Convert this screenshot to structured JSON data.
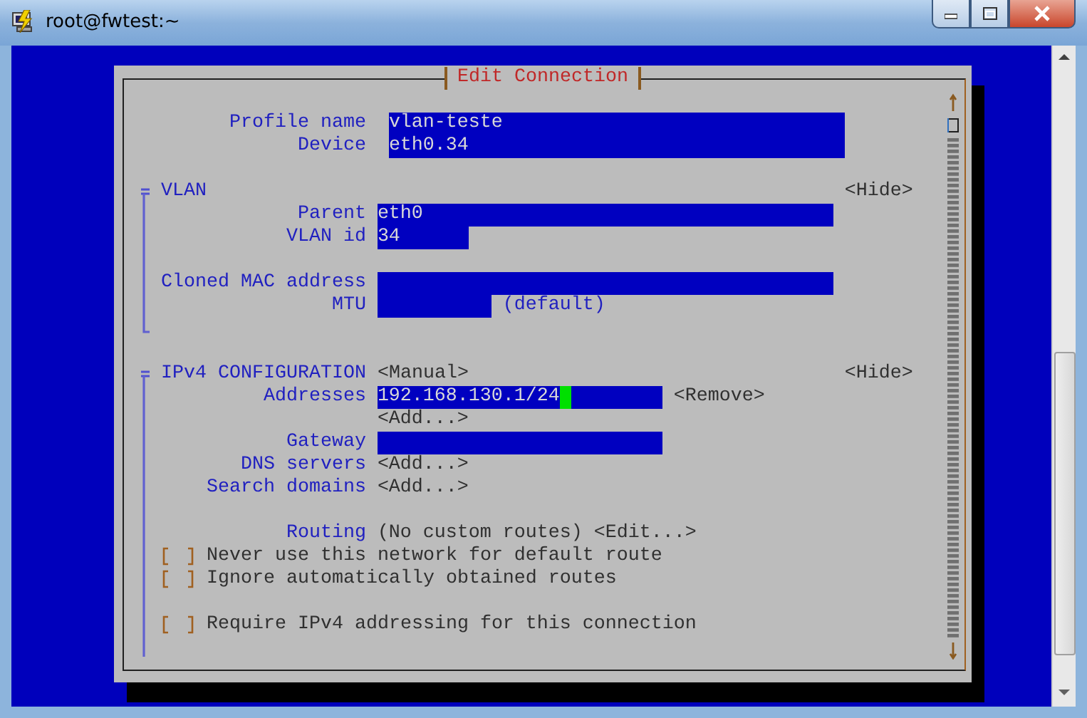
{
  "window": {
    "title": "root@fwtest:~"
  },
  "dialog": {
    "title": "Edit Connection"
  },
  "fields": [
    {
      "label": "Profile name",
      "value": "vlan-teste"
    },
    {
      "label": "Device",
      "value": "eth0.34"
    }
  ],
  "sections": [
    {
      "title": "VLAN",
      "hide_button": "<Hide>",
      "rows": [
        {
          "kind": "field",
          "label": "Parent",
          "value": "eth0"
        },
        {
          "kind": "field",
          "label": "VLAN id",
          "value": "34"
        },
        {
          "kind": "blank"
        },
        {
          "kind": "field",
          "label": "Cloned MAC address"
        },
        {
          "kind": "field",
          "label": "MTU",
          "note": "(default)"
        }
      ]
    },
    {
      "title": "IPv4 CONFIGURATION",
      "mode_button": "<Manual>",
      "hide_button": "<Hide>",
      "rows": [
        {
          "kind": "field",
          "label": "Addresses",
          "value": "192.168.130.1/24",
          "focused": true,
          "button": "<Remove>"
        },
        {
          "kind": "button",
          "button": "<Add...>"
        },
        {
          "kind": "field",
          "label": "Gateway"
        },
        {
          "kind": "button",
          "label": "DNS servers",
          "button": "<Add...>"
        },
        {
          "kind": "button",
          "label": "Search domains",
          "button": "<Add...>"
        },
        {
          "kind": "blank"
        },
        {
          "kind": "text",
          "label": "Routing",
          "text": "(No custom routes)",
          "button": "<Edit...>"
        },
        {
          "kind": "checkbox",
          "label": "Never use this network for default route",
          "checked": false
        },
        {
          "kind": "checkbox",
          "label": "Ignore automatically obtained routes",
          "checked": false
        },
        {
          "kind": "blank"
        },
        {
          "kind": "checkbox",
          "label": "Require IPv4 addressing for this connection",
          "checked": false
        }
      ]
    }
  ]
}
